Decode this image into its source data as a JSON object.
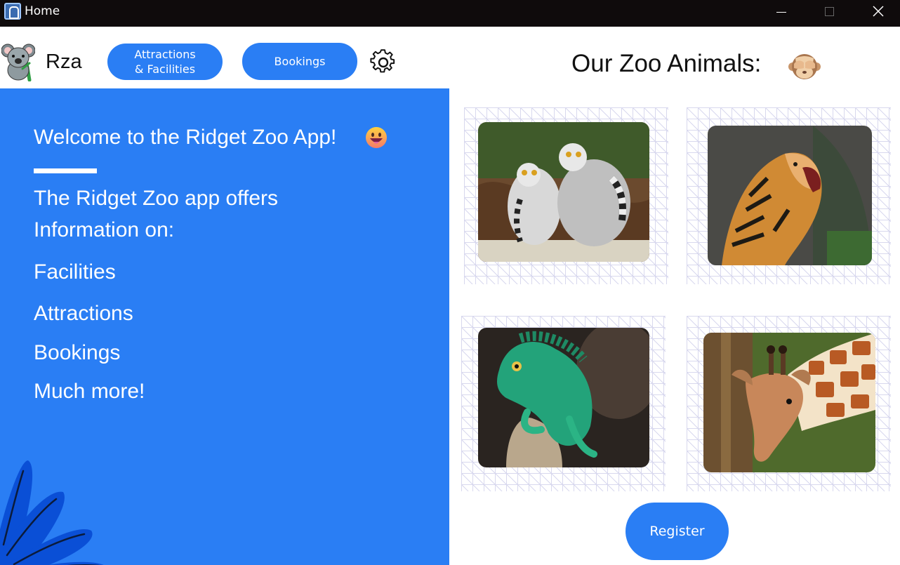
{
  "window": {
    "title": "Home",
    "icon": "app-window-icon",
    "controls": [
      "minimize-icon",
      "maximize-icon",
      "close-icon"
    ]
  },
  "header": {
    "logo_icon": "koala-icon",
    "brand": "Rza",
    "nav": [
      {
        "label_line1": "Attractions",
        "label_line2": "& Facilities"
      },
      {
        "label": "Bookings"
      }
    ],
    "settings_icon": "gear-icon"
  },
  "welcome_panel": {
    "heading": "Welcome to the Ridget Zoo App!",
    "heading_icon": "grinning-face-emoji",
    "intro_line1": "The Ridget Zoo app offers",
    "intro_line2": "Information on:",
    "features": [
      "Facilities",
      "Attractions",
      "Bookings",
      "Much more!"
    ]
  },
  "animals": {
    "title": "Our Zoo Animals:",
    "title_icon": "see-no-evil-monkey-emoji",
    "photos": [
      "lemurs-photo",
      "tiger-photo",
      "lizard-photo",
      "giraffe-photo"
    ]
  },
  "register_button": "Register",
  "colors": {
    "accent": "#2a7ef4",
    "titlebar": "#0f0b0c",
    "text_dark": "#111111",
    "text_light": "#ffffff"
  }
}
